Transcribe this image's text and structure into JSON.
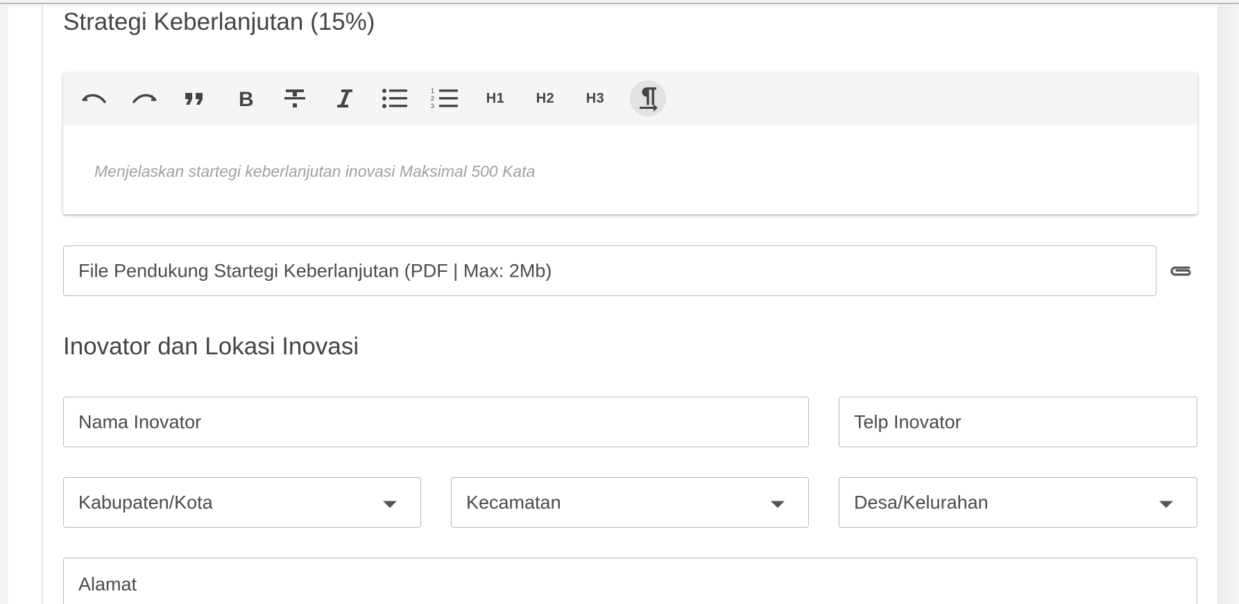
{
  "sections": {
    "sustainability_title": "Strategi Keberlanjutan (15%)",
    "innovator_title": "Inovator dan Lokasi Inovasi"
  },
  "editor": {
    "placeholder": "Menjelaskan startegi keberlanjutan inovasi Maksimal 500 Kata",
    "toolbar": [
      {
        "name": "undo-icon"
      },
      {
        "name": "redo-icon"
      },
      {
        "name": "blockquote-icon"
      },
      {
        "name": "bold-icon"
      },
      {
        "name": "strikethrough-icon"
      },
      {
        "name": "italic-icon"
      },
      {
        "name": "bullet-list-icon"
      },
      {
        "name": "ordered-list-icon"
      },
      {
        "name": "heading-1-button",
        "label": "H1"
      },
      {
        "name": "heading-2-button",
        "label": "H2"
      },
      {
        "name": "heading-3-button",
        "label": "H3"
      },
      {
        "name": "paragraph-icon",
        "active": true
      }
    ]
  },
  "upload": {
    "label": "File Pendukung Startegi Keberlanjutan (PDF | Max: 2Mb)",
    "icon": "paperclip-icon"
  },
  "form": {
    "nama_inovator": "Nama Inovator",
    "telp_inovator": "Telp Inovator",
    "kabupaten": "Kabupaten/Kota",
    "kecamatan": "Kecamatan",
    "desa": "Desa/Kelurahan",
    "alamat": "Alamat"
  },
  "colors": {
    "toolbar_bg": "#f5f5f5",
    "active_btn_bg": "#e2e2e2",
    "border": "#b8b8b8",
    "placeholder": "#a0a0a0"
  }
}
